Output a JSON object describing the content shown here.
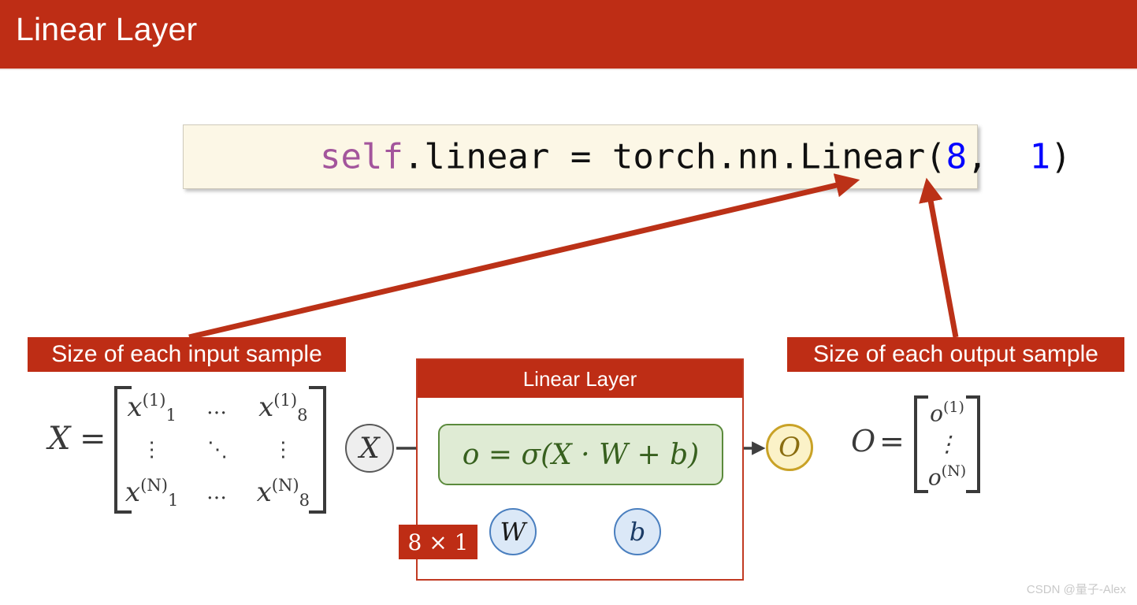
{
  "slide": {
    "title": "Linear Layer",
    "background_color": "#ffffff",
    "accent_color": "#be2d15"
  },
  "code_box": {
    "tokens": [
      {
        "text": "self",
        "color": "#a3559c"
      },
      {
        "text": ".linear = torch.nn.Linear(",
        "color": "#101010"
      },
      {
        "text": "8",
        "color": "#0000ff"
      },
      {
        "text": ",  ",
        "color": "#101010"
      },
      {
        "text": "1",
        "color": "#0000ff"
      },
      {
        "text": ")",
        "color": "#101010"
      }
    ],
    "full_text": "self.linear = torch.nn.Linear(8,  1)",
    "background_color": "#fcf7e6"
  },
  "callouts": {
    "input": "Size of each input sample",
    "output": "Size of each output sample"
  },
  "input_matrix": {
    "name": "X",
    "equals": "=",
    "cells": [
      [
        "x1(1)",
        "…",
        "x8(1)"
      ],
      [
        "⋮",
        "⋱",
        "⋮"
      ],
      [
        "x1(N)",
        "…",
        "x8(N)"
      ]
    ],
    "entries": {
      "r1c1": {
        "base": "x",
        "sub": "1",
        "sup": "(1)"
      },
      "r1c3": {
        "base": "x",
        "sub": "8",
        "sup": "(1)"
      },
      "r3c1": {
        "base": "x",
        "sub": "1",
        "sup": "(N)"
      },
      "r3c3": {
        "base": "x",
        "sub": "8",
        "sup": "(N)"
      },
      "h_dots": "…",
      "v_dots": "⋮",
      "d_dots": "⋱"
    }
  },
  "layer": {
    "header": "Linear Layer",
    "formula": "o = σ(X · W + b)",
    "formula_fill": "#dfebd4",
    "formula_stroke": "#5b8a3c",
    "formula_text_color": "#37601e",
    "input_node": "X",
    "output_node": "O",
    "weight_node": "W",
    "bias_node": "b",
    "shape_badge": "8 × 1"
  },
  "output_matrix": {
    "name": "O",
    "equals": "=",
    "entries": {
      "first": {
        "base": "o",
        "sup": "(1)"
      },
      "dots": "⋮",
      "last": {
        "base": "o",
        "sup": "(N)"
      }
    }
  },
  "watermark": "CSDN @量子-Alex"
}
